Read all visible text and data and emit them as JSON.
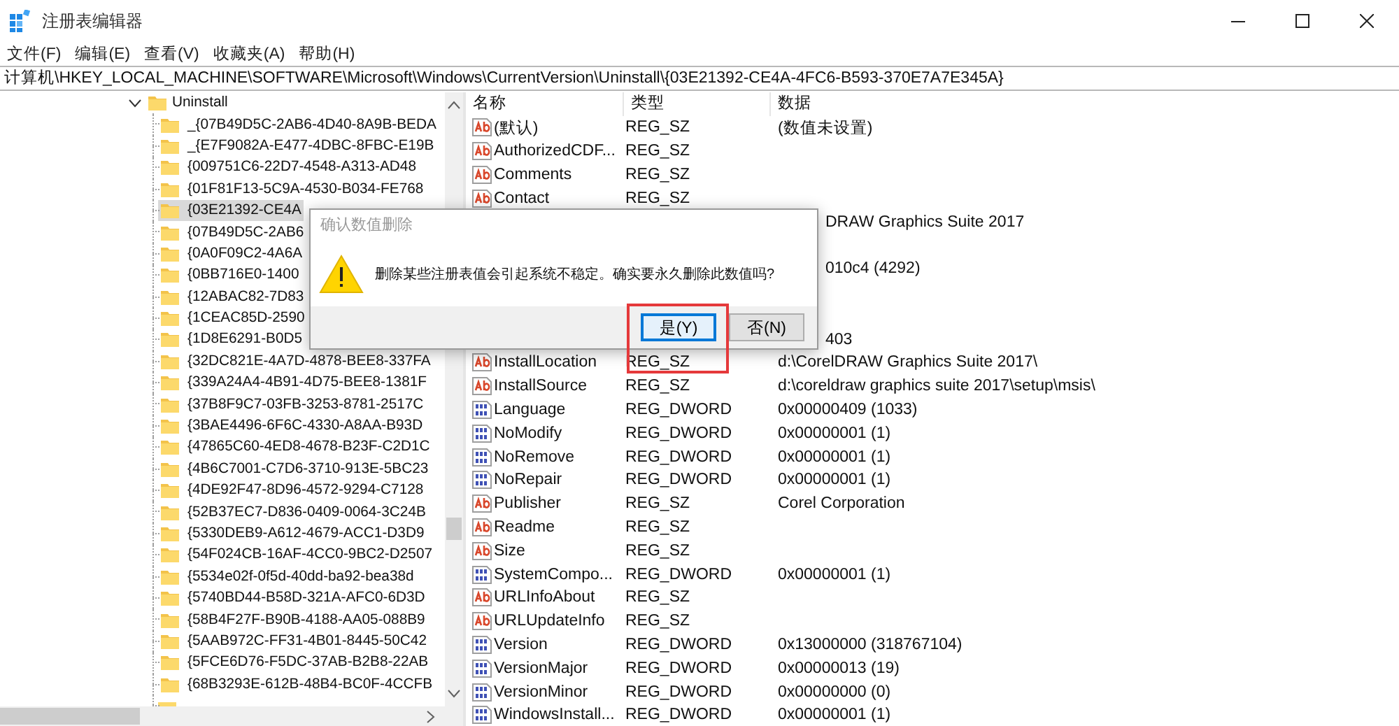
{
  "window": {
    "title": "注册表编辑器"
  },
  "menu": [
    "文件(F)",
    "编辑(E)",
    "查看(V)",
    "收藏夹(A)",
    "帮助(H)"
  ],
  "address": "计算机\\HKEY_LOCAL_MACHINE\\SOFTWARE\\Microsoft\\Windows\\CurrentVersion\\Uninstall\\{03E21392-CE4A-4FC6-B593-370E7A7E345A}",
  "tree": {
    "label": "Uninstall",
    "expanded": true,
    "children": [
      {
        "label": "_{07B49D5C-2AB6-4D40-8A9B-BEDA",
        "selected": false
      },
      {
        "label": "_{E7F9082A-E477-4DBC-8FBC-E19B",
        "selected": false
      },
      {
        "label": "{009751C6-22D7-4548-A313-AD48",
        "selected": false
      },
      {
        "label": "{01F81F13-5C9A-4530-B034-FE768",
        "selected": false
      },
      {
        "label": "{03E21392-CE4A",
        "selected": true
      },
      {
        "label": "{07B49D5C-2AB6",
        "selected": false
      },
      {
        "label": "{0A0F09C2-4A6A",
        "selected": false
      },
      {
        "label": "{0BB716E0-1400",
        "selected": false
      },
      {
        "label": "{12ABAC82-7D83",
        "selected": false
      },
      {
        "label": "{1CEAC85D-2590",
        "selected": false
      },
      {
        "label": "{1D8E6291-B0D5",
        "selected": false
      },
      {
        "label": "{32DC821E-4A7D-4878-BEE8-337FA",
        "selected": false
      },
      {
        "label": "{339A24A4-4B91-4D75-BEE8-1381F",
        "selected": false
      },
      {
        "label": "{37B8F9C7-03FB-3253-8781-2517C",
        "selected": false
      },
      {
        "label": "{3BAE4496-6F6C-4330-A8AA-B93D",
        "selected": false
      },
      {
        "label": "{47865C60-4ED8-4678-B23F-C2D1C",
        "selected": false
      },
      {
        "label": "{4B6C7001-C7D6-3710-913E-5BC23",
        "selected": false
      },
      {
        "label": "{4DE92F47-8D96-4572-9294-C7128",
        "selected": false
      },
      {
        "label": "{52B37EC7-D836-0409-0064-3C24B",
        "selected": false
      },
      {
        "label": "{5330DEB9-A612-4679-ACC1-D3D9",
        "selected": false
      },
      {
        "label": "{54F024CB-16AF-4CC0-9BC2-D2507",
        "selected": false
      },
      {
        "label": "{5534e02f-0f5d-40dd-ba92-bea38d",
        "selected": false
      },
      {
        "label": "{5740BD44-B58D-321A-AFC0-6D3D",
        "selected": false
      },
      {
        "label": "{58B4F27F-B90B-4188-AA05-088B9",
        "selected": false
      },
      {
        "label": "{5AAB972C-FF31-4B01-8445-50C42",
        "selected": false
      },
      {
        "label": "{5FCE6D76-F5DC-37AB-B2B8-22AB",
        "selected": false
      },
      {
        "label": "{68B3293E-612B-48B4-BC0F-4CCFB",
        "selected": false
      }
    ]
  },
  "columns": [
    "名称",
    "类型",
    "数据"
  ],
  "rows": [
    {
      "kind": "string",
      "name": "(默认)",
      "type": "REG_SZ",
      "data": "(数值未设置)"
    },
    {
      "kind": "string",
      "name": "AuthorizedCDF...",
      "type": "REG_SZ"
    },
    {
      "kind": "string",
      "name": "Comments",
      "type": "REG_SZ"
    },
    {
      "kind": "string",
      "name": "Contact",
      "type": "REG_SZ"
    },
    {
      "data": "DRAW Graphics Suite 2017"
    },
    {},
    {
      "data": "010c4 (4292)"
    },
    {},
    {},
    {
      "data": "403"
    },
    {
      "kind": "string",
      "name": "InstallLocation",
      "type": "REG_SZ",
      "data": "d:\\CorelDRAW Graphics Suite 2017\\"
    },
    {
      "kind": "string",
      "name": "InstallSource",
      "type": "REG_SZ",
      "data": "d:\\coreldraw graphics suite 2017\\setup\\msis\\"
    },
    {
      "kind": "dword",
      "name": "Language",
      "type": "REG_DWORD",
      "data": "0x00000409 (1033)"
    },
    {
      "kind": "dword",
      "name": "NoModify",
      "type": "REG_DWORD",
      "data": "0x00000001 (1)"
    },
    {
      "kind": "dword",
      "name": "NoRemove",
      "type": "REG_DWORD",
      "data": "0x00000001 (1)"
    },
    {
      "kind": "dword",
      "name": "NoRepair",
      "type": "REG_DWORD",
      "data": "0x00000001 (1)"
    },
    {
      "kind": "string",
      "name": "Publisher",
      "type": "REG_SZ",
      "data": "Corel Corporation"
    },
    {
      "kind": "string",
      "name": "Readme",
      "type": "REG_SZ"
    },
    {
      "kind": "string",
      "name": "Size",
      "type": "REG_SZ"
    },
    {
      "kind": "dword",
      "name": "SystemCompo...",
      "type": "REG_DWORD",
      "data": "0x00000001 (1)"
    },
    {
      "kind": "string",
      "name": "URLInfoAbout",
      "type": "REG_SZ"
    },
    {
      "kind": "string",
      "name": "URLUpdateInfo",
      "type": "REG_SZ"
    },
    {
      "kind": "dword",
      "name": "Version",
      "type": "REG_DWORD",
      "data": "0x13000000 (318767104)"
    },
    {
      "kind": "dword",
      "name": "VersionMajor",
      "type": "REG_DWORD",
      "data": "0x00000013 (19)"
    },
    {
      "kind": "dword",
      "name": "VersionMinor",
      "type": "REG_DWORD",
      "data": "0x00000000 (0)"
    },
    {
      "kind": "dword",
      "name": "WindowsInstall...",
      "type": "REG_DWORD",
      "data": "0x00000001 (1)"
    }
  ],
  "dialog": {
    "title": "确认数值删除",
    "message": "删除某些注册表值会引起系统不稳定。确实要永久删除此数值吗?",
    "buttons": [
      {
        "label": "是(Y)",
        "selected": true
      },
      {
        "label": "否(N)",
        "selected": false
      }
    ]
  }
}
